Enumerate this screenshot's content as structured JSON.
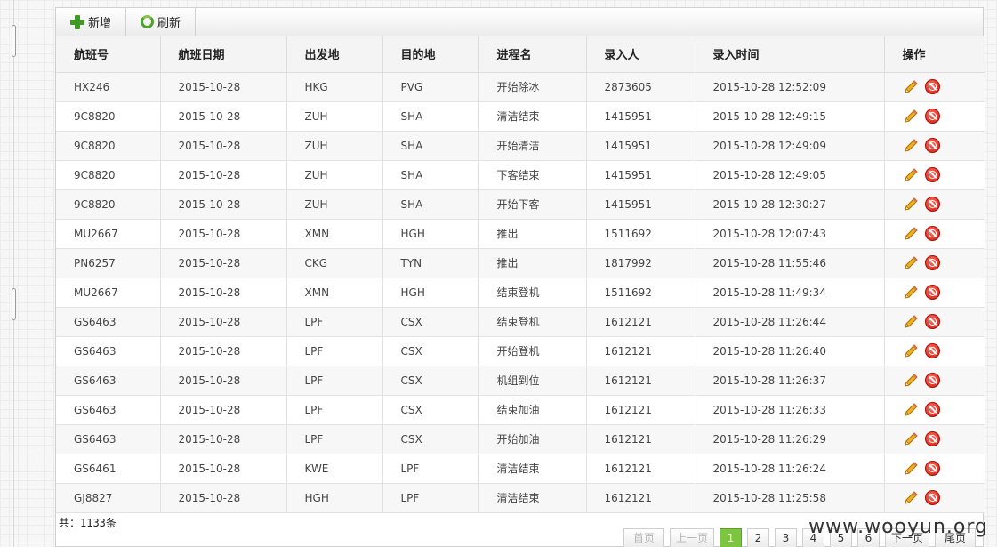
{
  "toolbar": {
    "add_label": "新增",
    "refresh_label": "刷新"
  },
  "table": {
    "headers": [
      "航班号",
      "航班日期",
      "出发地",
      "目的地",
      "进程名",
      "录入人",
      "录入时间",
      "操作"
    ],
    "rows": [
      [
        "HX246",
        "2015-10-28",
        "HKG",
        "PVG",
        "开始除冰",
        "2873605",
        "2015-10-28 12:52:09"
      ],
      [
        "9C8820",
        "2015-10-28",
        "ZUH",
        "SHA",
        "清洁结束",
        "1415951",
        "2015-10-28 12:49:15"
      ],
      [
        "9C8820",
        "2015-10-28",
        "ZUH",
        "SHA",
        "开始清洁",
        "1415951",
        "2015-10-28 12:49:09"
      ],
      [
        "9C8820",
        "2015-10-28",
        "ZUH",
        "SHA",
        "下客结束",
        "1415951",
        "2015-10-28 12:49:05"
      ],
      [
        "9C8820",
        "2015-10-28",
        "ZUH",
        "SHA",
        "开始下客",
        "1415951",
        "2015-10-28 12:30:27"
      ],
      [
        "MU2667",
        "2015-10-28",
        "XMN",
        "HGH",
        "推出",
        "1511692",
        "2015-10-28 12:07:43"
      ],
      [
        "PN6257",
        "2015-10-28",
        "CKG",
        "TYN",
        "推出",
        "1817992",
        "2015-10-28 11:55:46"
      ],
      [
        "MU2667",
        "2015-10-28",
        "XMN",
        "HGH",
        "结束登机",
        "1511692",
        "2015-10-28 11:49:34"
      ],
      [
        "GS6463",
        "2015-10-28",
        "LPF",
        "CSX",
        "结束登机",
        "1612121",
        "2015-10-28 11:26:44"
      ],
      [
        "GS6463",
        "2015-10-28",
        "LPF",
        "CSX",
        "开始登机",
        "1612121",
        "2015-10-28 11:26:40"
      ],
      [
        "GS6463",
        "2015-10-28",
        "LPF",
        "CSX",
        "机组到位",
        "1612121",
        "2015-10-28 11:26:37"
      ],
      [
        "GS6463",
        "2015-10-28",
        "LPF",
        "CSX",
        "结束加油",
        "1612121",
        "2015-10-28 11:26:33"
      ],
      [
        "GS6463",
        "2015-10-28",
        "LPF",
        "CSX",
        "开始加油",
        "1612121",
        "2015-10-28 11:26:29"
      ],
      [
        "GS6461",
        "2015-10-28",
        "KWE",
        "LPF",
        "清洁结束",
        "1612121",
        "2015-10-28 11:26:24"
      ],
      [
        "GJ8827",
        "2015-10-28",
        "HGH",
        "LPF",
        "清洁结束",
        "1612121",
        "2015-10-28 11:25:58"
      ]
    ]
  },
  "footer": {
    "total_text": "共：1133条",
    "pager": {
      "first": "首页",
      "prev": "上一页",
      "pages": [
        "1",
        "2",
        "3",
        "4",
        "5",
        "6"
      ],
      "current": "1",
      "next": "下一页",
      "last": "尾页"
    }
  },
  "watermark": "www.wooyun.org",
  "icons": {
    "add": "plus-icon",
    "refresh": "refresh-icon",
    "edit": "pencil-icon",
    "delete": "delete-icon"
  },
  "colors": {
    "active_page": "#7dc441",
    "delete": "#d11a10",
    "add": "#3e9a25"
  }
}
